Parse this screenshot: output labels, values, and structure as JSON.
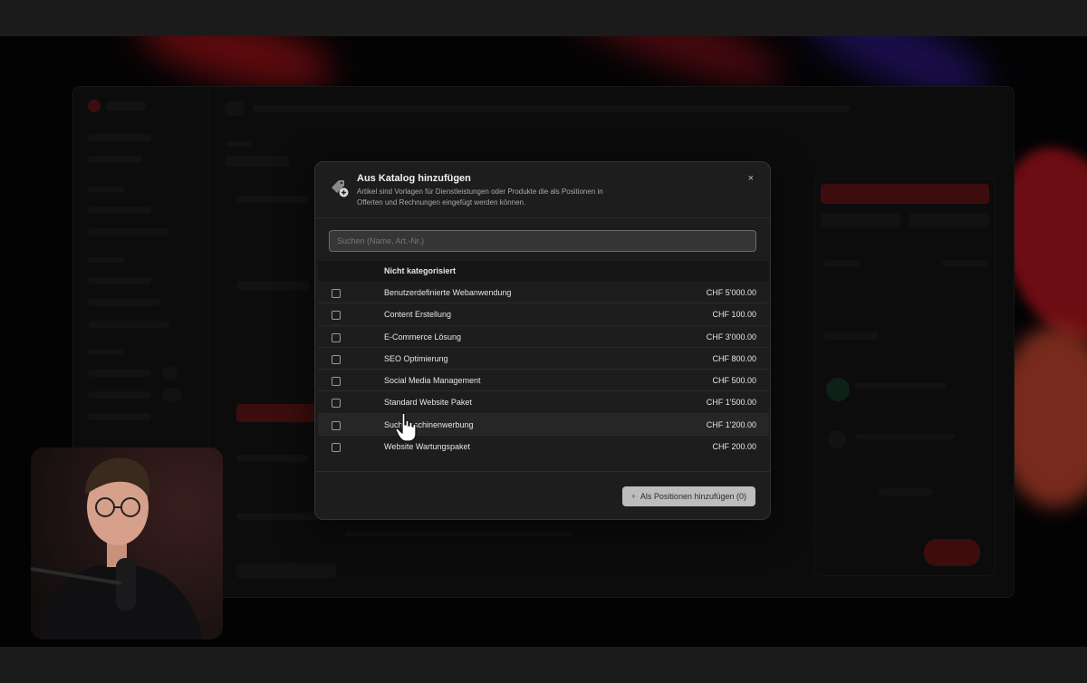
{
  "modal": {
    "title": "Aus Katalog hinzufügen",
    "description": "Artikel sind Vorlagen für Dienstleistungen oder Produkte die als Positionen in Offerten und Rechnungen eingefügt werden können.",
    "close_label": "×",
    "search_placeholder": "Suchen (Name, Art.-Nr.)",
    "category": "Nicht kategorisiert",
    "items": [
      {
        "name": "Benutzerdefinierte Webanwendung",
        "price": "CHF 5'000.00"
      },
      {
        "name": "Content Erstellung",
        "price": "CHF 100.00"
      },
      {
        "name": "E-Commerce Lösung",
        "price": "CHF 3'000.00"
      },
      {
        "name": "SEO Optimierung",
        "price": "CHF 800.00"
      },
      {
        "name": "Social Media Management",
        "price": "CHF 500.00"
      },
      {
        "name": "Standard Website Paket",
        "price": "CHF 1'500.00"
      },
      {
        "name": "Suchmaschinenwerbung",
        "price": "CHF 1'200.00"
      },
      {
        "name": "Website Wartungspaket",
        "price": "CHF 200.00"
      }
    ],
    "add_button_label": "Als Positionen hinzufügen (0)"
  },
  "icons": {
    "catalog": "tag-plus-icon",
    "close": "close-icon",
    "add": "plus-icon",
    "cursor": "hand-pointer-icon"
  },
  "colors": {
    "modal_bg": "#1d1d1d",
    "button_bg": "#bdbdbd",
    "accent_red": "#c4161c"
  }
}
